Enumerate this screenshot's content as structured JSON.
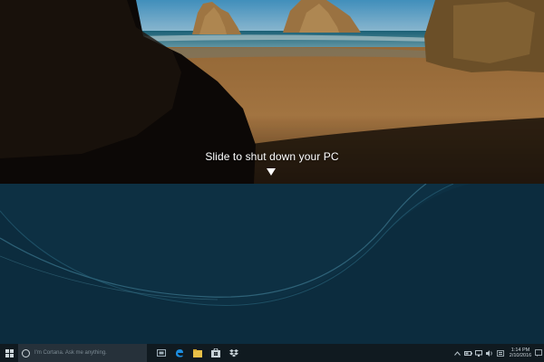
{
  "lock_overlay": {
    "prompt": "Slide to shut down your PC",
    "arrow_icon": "down-triangle-icon"
  },
  "taskbar": {
    "search_placeholder": "I'm Cortana. Ask me anything.",
    "pinned": [
      "task-view-icon",
      "edge-browser-icon",
      "file-explorer-icon",
      "store-icon",
      "dropbox-icon"
    ],
    "tray_icons": [
      "chevron-up-icon",
      "battery-icon",
      "network-icon",
      "volume-icon",
      "language-icon"
    ],
    "clock_time": "1:14 PM",
    "clock_date": "2/10/2016"
  },
  "colors": {
    "taskbar": "#101a20",
    "desktop": "#0f3346",
    "accent": "#1d8ee0"
  }
}
